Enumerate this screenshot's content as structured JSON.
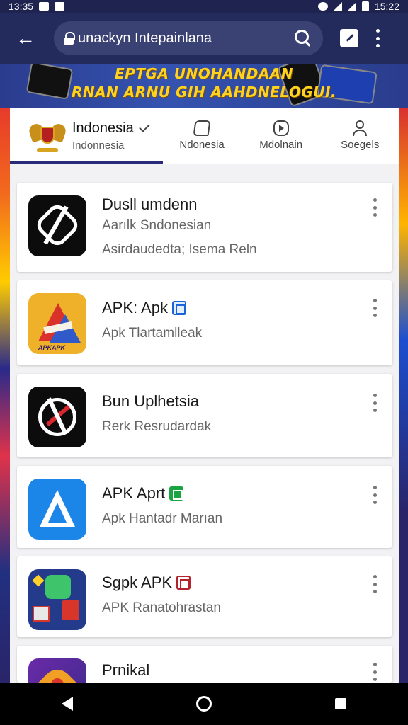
{
  "status_bar": {
    "time_left": "13:35",
    "time_right": "15:22"
  },
  "browser": {
    "url_text": "unackyn Intepainlana",
    "icons": [
      "back-arrow-icon",
      "lock-icon",
      "search-icon",
      "edit-icon",
      "overflow-menu-icon"
    ]
  },
  "banner": {
    "line1": "EPTGA UNOHANDAAN",
    "line2": "RNAN ARNU GIH AAHDNELOGUI."
  },
  "tabs": {
    "primary_title": "Indonesia",
    "primary_sub": "Indonnesia",
    "items": [
      {
        "label": "Ndonesia",
        "icon": "bookmark-icon"
      },
      {
        "label": "Mdolnain",
        "icon": "play-icon"
      },
      {
        "label": "Soegels",
        "icon": "person-icon"
      }
    ]
  },
  "apps": [
    {
      "name": "Dusll umdenn",
      "sub1": "Aarılk Sndonesian",
      "sub2": "Asirdaudedta; Isema Reln",
      "icon": "app-black-a-icon",
      "badge": ""
    },
    {
      "name": "APK: Apk",
      "sub1": "Apk Tlartamlleak",
      "sub2": "",
      "icon": "app-star-icon",
      "badge": "blue"
    },
    {
      "name": "Bun Uplhetsia",
      "sub1": "Rerk Resrudardak",
      "sub2": "",
      "icon": "app-circle-a-icon",
      "badge": ""
    },
    {
      "name": "APK Aprt",
      "sub1": "Apk Hantadr Marıan",
      "sub2": "",
      "icon": "app-blue-a-icon",
      "badge": "green"
    },
    {
      "name": "Sgpk APK",
      "sub1": "APK Ranatohrastan",
      "sub2": "",
      "icon": "app-multi-icon",
      "badge": "red"
    },
    {
      "name": "Prnikal",
      "sub1": "",
      "sub2": "",
      "icon": "app-flower-icon",
      "badge": ""
    }
  ],
  "nav": {
    "icons": [
      "nav-back-icon",
      "nav-home-icon",
      "nav-recents-icon"
    ]
  },
  "colors": {
    "browser_bg": "#232a5c",
    "tab_indicator": "#2a2a7a",
    "banner_text": "#ffd21f"
  }
}
